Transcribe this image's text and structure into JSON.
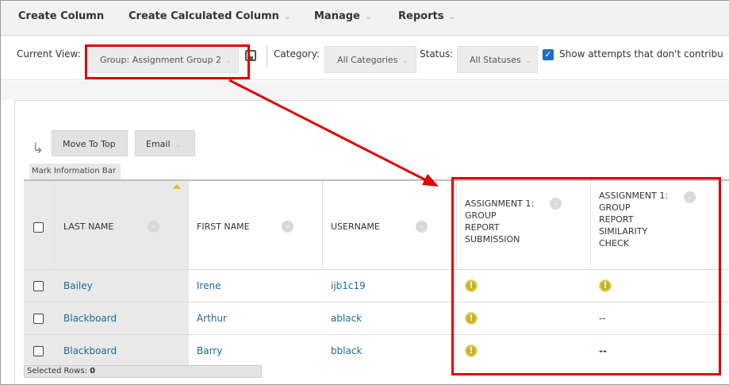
{
  "menu": {
    "create_column": "Create Column",
    "create_calculated_column": "Create Calculated Column",
    "manage": "Manage",
    "reports": "Reports"
  },
  "viewbar": {
    "current_view_label": "Current View:",
    "current_view_value": "Group: Assignment Group 2",
    "category_label": "Category:",
    "category_value": "All Categories",
    "status_label": "Status:",
    "status_value": "All Statuses",
    "show_attempts": "Show attempts that don't contribu",
    "show_attempts_checked": true
  },
  "toolbar": {
    "move_to_top": "Move To Top",
    "email": "Email",
    "mark_info_bar": "Mark Information Bar"
  },
  "table": {
    "columns": [
      {
        "name": "last-name",
        "label": "LAST NAME"
      },
      {
        "name": "first-name",
        "label": "FIRST NAME"
      },
      {
        "name": "username",
        "label": "USERNAME"
      },
      {
        "name": "assignment-1",
        "lines": [
          "ASSIGNMENT 1:",
          "GROUP",
          "REPORT",
          "SUBMISSION"
        ]
      },
      {
        "name": "assignment-2",
        "lines": [
          "ASSIGNMENT 1:",
          "GROUP",
          "REPORT",
          "SIMILARITY",
          "CHECK"
        ]
      }
    ],
    "rows": [
      {
        "last": "Bailey",
        "first": "Irene",
        "username": "ijb1c19",
        "a1": "warning",
        "a2": "warning"
      },
      {
        "last": "Blackboard",
        "first": "Arthur",
        "username": "ablack",
        "a1": "warning",
        "a2": "--"
      },
      {
        "last": "Blackboard",
        "first": "Barry",
        "username": "bblack",
        "a1": "warning",
        "a2": "--"
      }
    ],
    "selected_rows_label": "Selected Rows: ",
    "selected_rows_count": "0"
  },
  "icons": {
    "warning": "exclamation-circle-icon",
    "column_menu": "chevron-down-circle-icon",
    "sort": "sort-ascending-icon",
    "save": "save-view-icon"
  },
  "colors": {
    "annotation_red": "#e00000",
    "link_blue": "#1a6a9a",
    "warning_yellow": "#c9b22a",
    "checkbox_blue": "#1a6fc2"
  }
}
